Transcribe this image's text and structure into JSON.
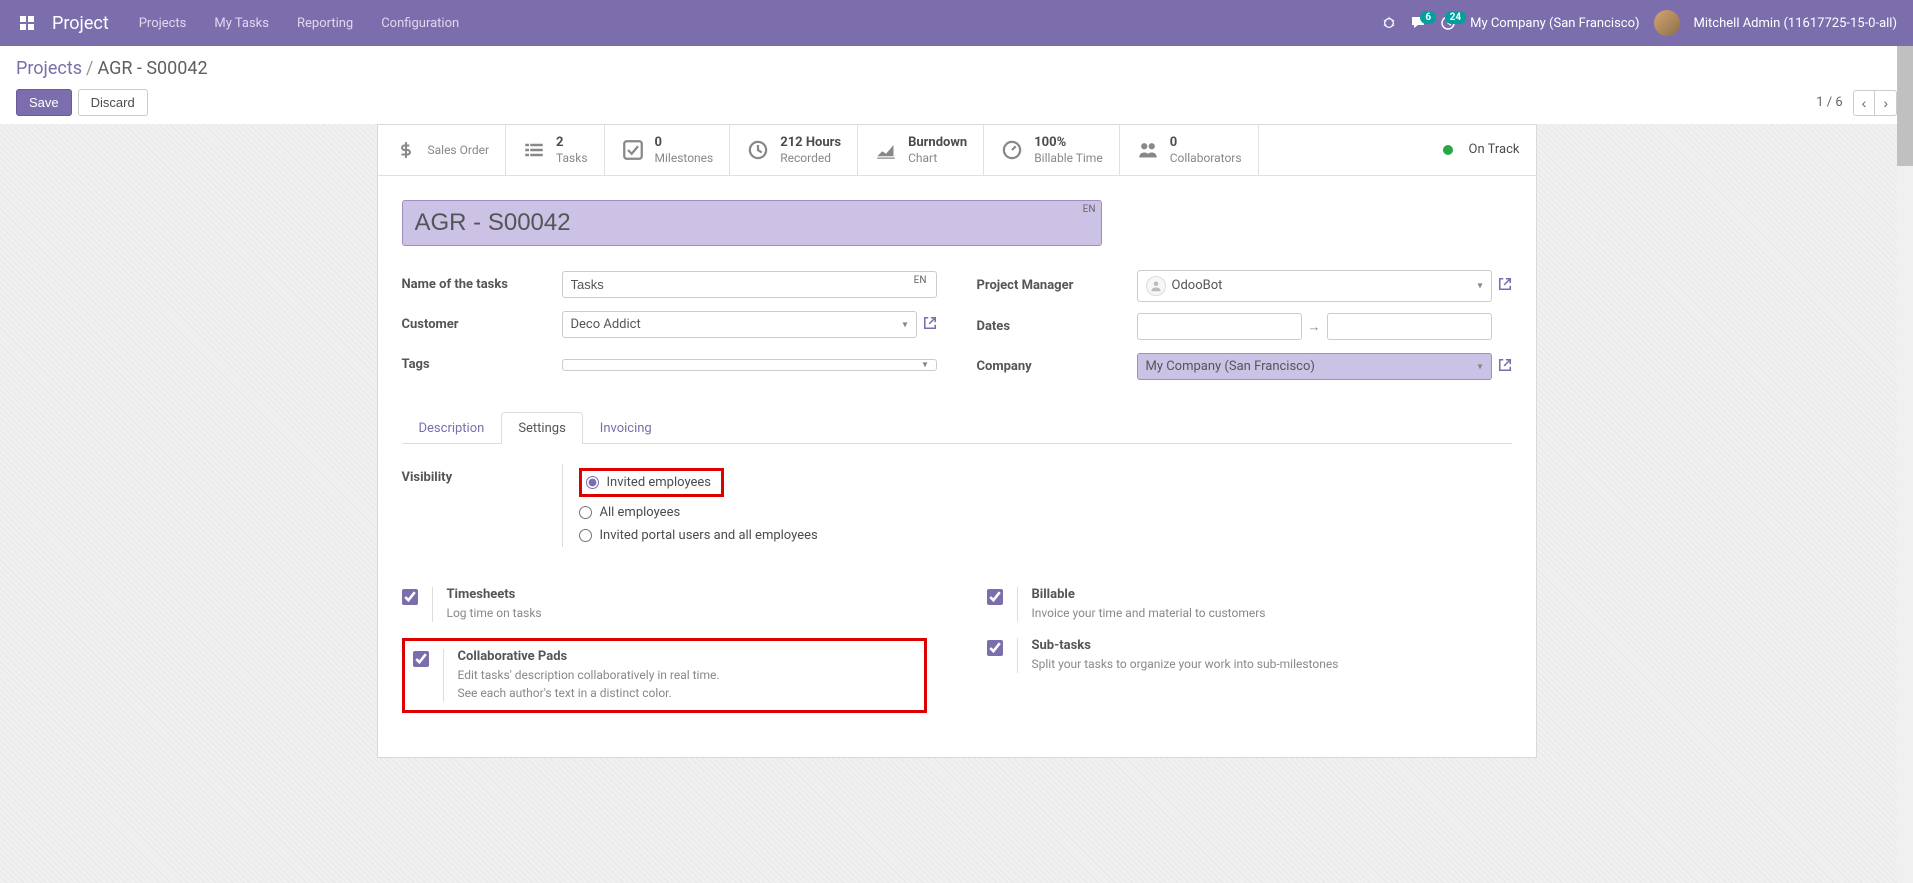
{
  "nav": {
    "brand": "Project",
    "menu": [
      "Projects",
      "My Tasks",
      "Reporting",
      "Configuration"
    ],
    "messages_badge": "6",
    "activities_badge": "24",
    "company": "My Company (San Francisco)",
    "user": "Mitchell Admin (11617725-15-0-all)"
  },
  "breadcrumb": {
    "parent": "Projects",
    "current": "AGR - S00042"
  },
  "toolbar": {
    "save": "Save",
    "discard": "Discard",
    "pager": "1 / 6"
  },
  "stats": {
    "sales_order": "Sales Order",
    "tasks": {
      "value": "2",
      "label": "Tasks"
    },
    "milestones": {
      "value": "0",
      "label": "Milestones"
    },
    "recorded": {
      "value": "212 Hours",
      "label": "Recorded"
    },
    "burndown": {
      "value": "Burndown",
      "label": "Chart"
    },
    "billable": {
      "value": "100%",
      "label": "Billable Time"
    },
    "collaborators": {
      "value": "0",
      "label": "Collaborators"
    },
    "status": "On Track"
  },
  "form": {
    "title": "AGR - S00042",
    "lang": "EN",
    "labels": {
      "name_tasks": "Name of the tasks",
      "customer": "Customer",
      "tags": "Tags",
      "manager": "Project Manager",
      "dates": "Dates",
      "company": "Company"
    },
    "values": {
      "name_tasks": "Tasks",
      "customer": "Deco Addict",
      "tags": "",
      "manager": "OdooBot",
      "date_from": "",
      "date_to": "",
      "company": "My Company (San Francisco)"
    }
  },
  "tabs": [
    "Description",
    "Settings",
    "Invoicing"
  ],
  "visibility": {
    "label": "Visibility",
    "opt1": "Invited employees",
    "opt2": "All employees",
    "opt3": "Invited portal users and all employees"
  },
  "settings": {
    "timesheets": {
      "title": "Timesheets",
      "desc": "Log time on tasks"
    },
    "billable": {
      "title": "Billable",
      "desc": "Invoice your time and material to customers"
    },
    "pads": {
      "title": "Collaborative Pads",
      "desc1": "Edit tasks' description collaboratively in real time.",
      "desc2": "See each author's text in a distinct color."
    },
    "subtasks": {
      "title": "Sub-tasks",
      "desc": "Split your tasks to organize your work into sub-milestones"
    }
  }
}
